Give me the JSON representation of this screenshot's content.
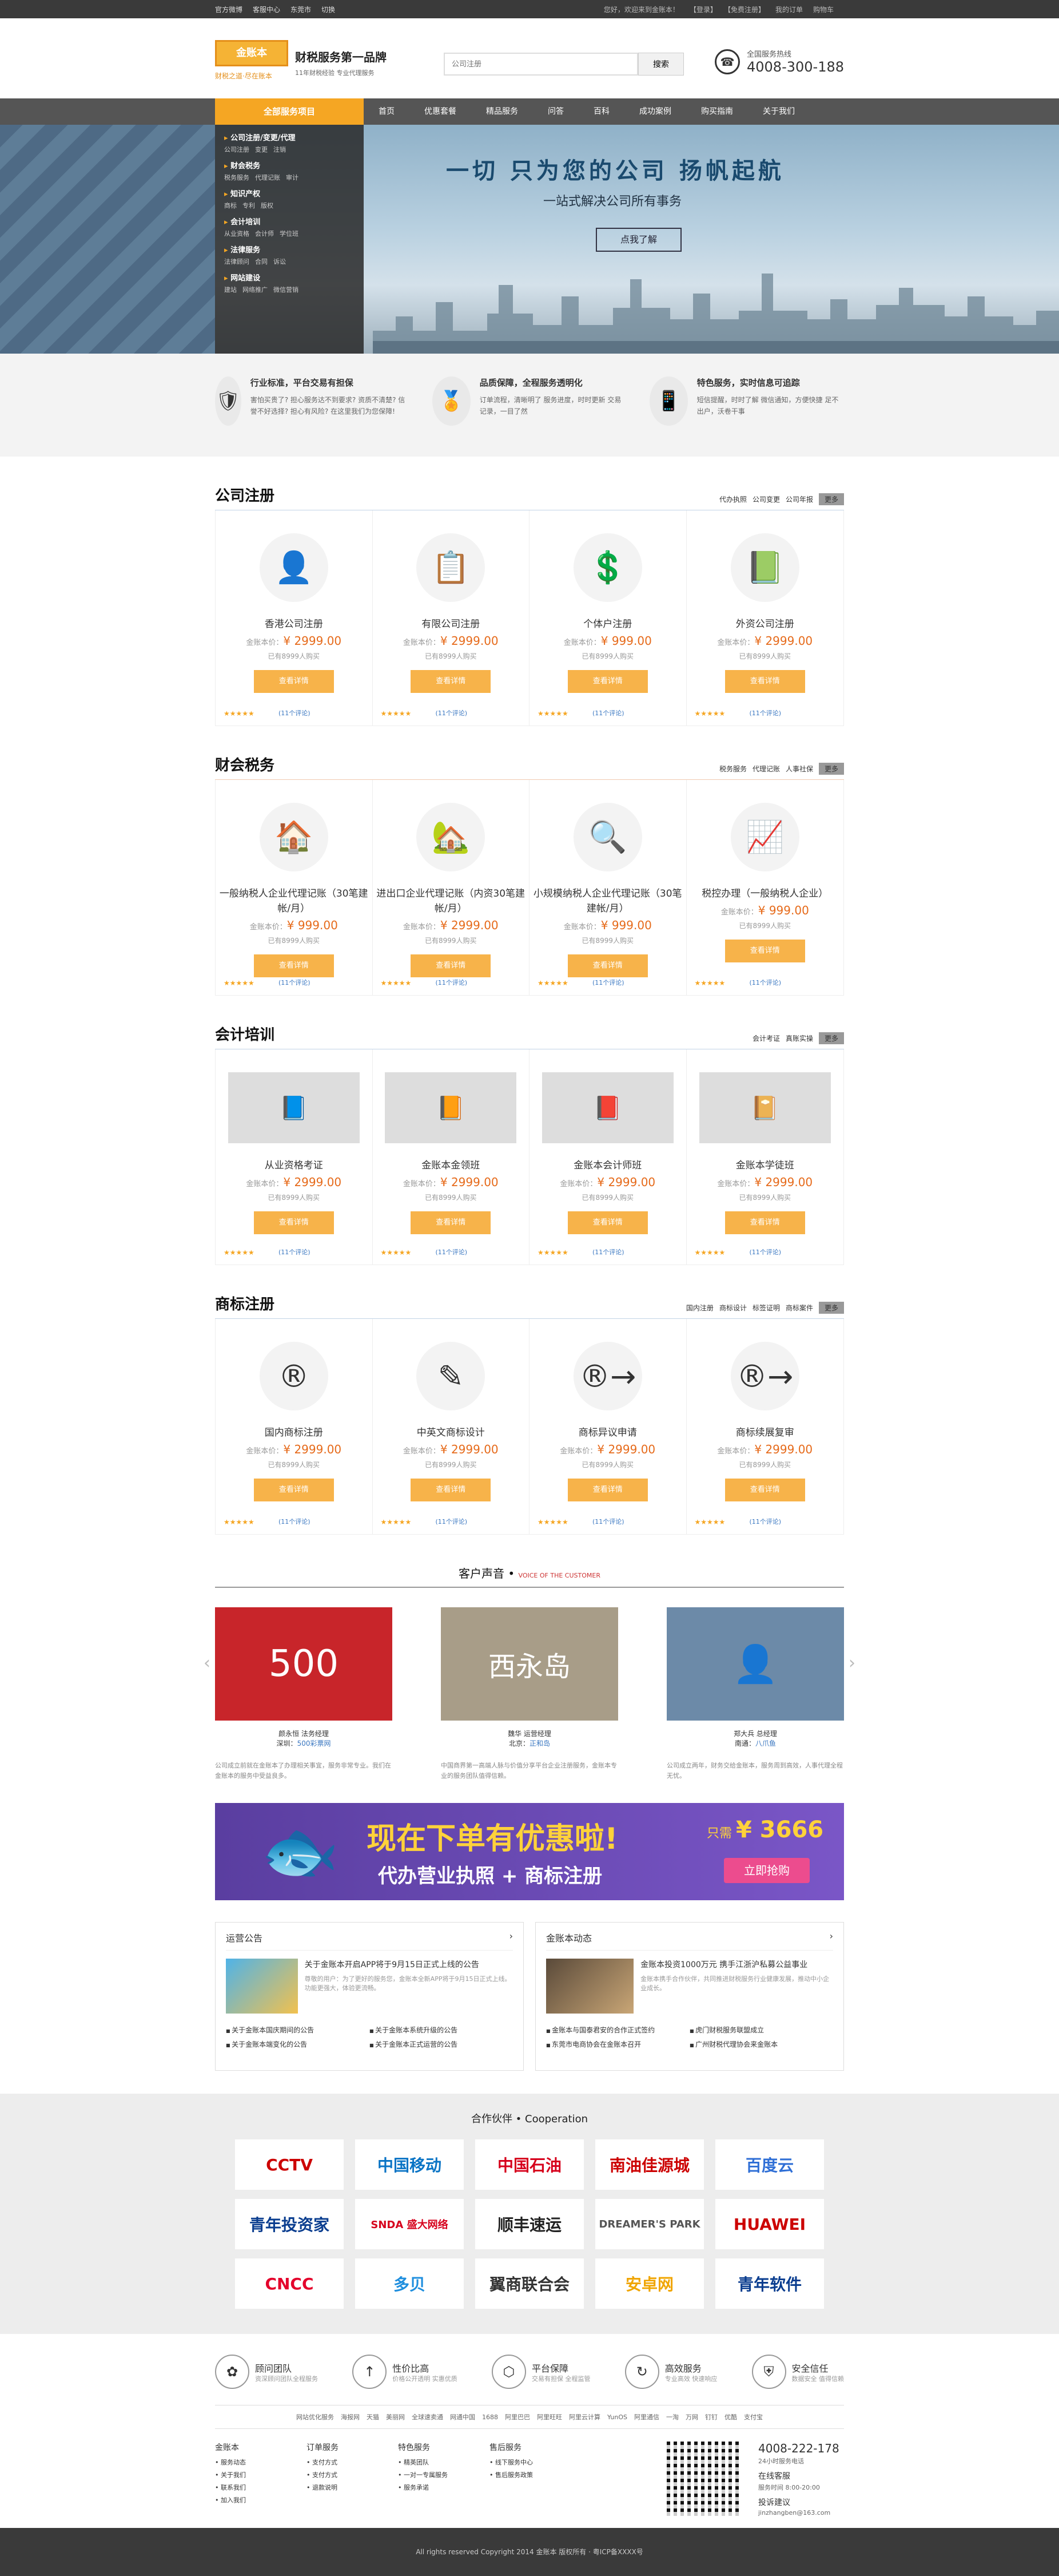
{
  "topbar": {
    "l1": "官方微博",
    "l2": "客服中心",
    "l3": "东莞市",
    "l4": "切换",
    "r1": "您好，欢迎来到金账本！",
    "r2": "【登录】",
    "r3": "【免费注册】",
    "r4": "我的订单",
    "r5": "购物车"
  },
  "header": {
    "logo": "金账本",
    "logo_sub": "财税之道·尽在账本",
    "slogan": "财税服务第一品牌",
    "slogan_sub": "11年财税经验 专业代理服务",
    "search_placeholder": "公司注册",
    "search_btn": "搜索",
    "phone_label": "全国服务热线",
    "phone": "4008-300-188"
  },
  "nav": {
    "all": "全部服务项目",
    "items": [
      "首页",
      "优惠套餐",
      "精品服务",
      "问答",
      "百科",
      "成功案例",
      "购买指南",
      "关于我们"
    ]
  },
  "banner": {
    "title": "一切 只为您的公司 扬帆起航",
    "sub": "一站式解决公司所有事务",
    "btn": "点我了解",
    "menu": [
      {
        "h": "公司注册/变更/代理",
        "s": [
          "公司注册",
          "变更",
          "注销"
        ]
      },
      {
        "h": "财会税务",
        "s": [
          "税务服务",
          "代理记账",
          "审计"
        ]
      },
      {
        "h": "知识产权",
        "s": [
          "商标",
          "专利",
          "版权"
        ]
      },
      {
        "h": "会计培训",
        "s": [
          "从业资格",
          "会计师",
          "学位班"
        ]
      },
      {
        "h": "法律服务",
        "s": [
          "法律顾问",
          "合同",
          "诉讼"
        ]
      },
      {
        "h": "网站建设",
        "s": [
          "建站",
          "网络推广",
          "微信营销"
        ]
      }
    ]
  },
  "adv": [
    {
      "t": "行业标准，平台交易有担保",
      "d": "害怕买贵了? 担心服务达不到要求? 资质不清楚? 信誉不好选择? 担心有风险? 在这里我们为您保障!"
    },
    {
      "t": "品质保障，全程服务透明化",
      "d": "订单流程，清晰明了 服务进度，时时更新 交易记录，一目了然"
    },
    {
      "t": "特色服务，实时信息可追踪",
      "d": "短信提醒，时时了解 微信通知，方便快捷 足不出户，沃卷干事"
    }
  ],
  "sections": [
    {
      "t": "公司注册",
      "links": [
        "代办执照",
        "公司变更",
        "公司年报"
      ],
      "cards": [
        {
          "ic": "👤",
          "nm": "香港公司注册",
          "p": "¥ 2999.00",
          "s": "已有8999人购买"
        },
        {
          "ic": "📋",
          "nm": "有限公司注册",
          "p": "¥ 2999.00",
          "s": "已有8999人购买"
        },
        {
          "ic": "💲",
          "nm": "个体户注册",
          "p": "¥ 999.00",
          "s": "已有8999人购买"
        },
        {
          "ic": "📗",
          "nm": "外资公司注册",
          "p": "¥ 2999.00",
          "s": "已有8999人购买"
        }
      ]
    },
    {
      "t": "财会税务",
      "links": [
        "税务服务",
        "代理记账",
        "人事社保"
      ],
      "cards": [
        {
          "ic": "🏠",
          "nm": "一般纳税人企业代理记账（30笔建帐/月）",
          "p": "¥ 999.00",
          "s": "已有8999人购买"
        },
        {
          "ic": "🏡",
          "nm": "进出口企业代理记账（内资30笔建帐/月）",
          "p": "¥ 2999.00",
          "s": "已有8999人购买"
        },
        {
          "ic": "🔍",
          "nm": "小规模纳税人企业代理记账（30笔建帐/月）",
          "p": "¥ 999.00",
          "s": "已有8999人购买"
        },
        {
          "ic": "📈",
          "nm": "税控办理（一般纳税人企业）",
          "p": "¥ 999.00",
          "s": "已有8999人购买"
        }
      ]
    },
    {
      "t": "会计培训",
      "links": [
        "会计考证",
        "真账实操"
      ],
      "cards": [
        {
          "ic": "📘",
          "nm": "从业资格考证",
          "p": "¥ 2999.00",
          "s": "已有8999人购买"
        },
        {
          "ic": "📙",
          "nm": "金账本金领班",
          "p": "¥ 2999.00",
          "s": "已有8999人购买"
        },
        {
          "ic": "📕",
          "nm": "金账本会计师班",
          "p": "¥ 2999.00",
          "s": "已有8999人购买"
        },
        {
          "ic": "📔",
          "nm": "金账本学徒班",
          "p": "¥ 2999.00",
          "s": "已有8999人购买"
        }
      ]
    },
    {
      "t": "商标注册",
      "links": [
        "国内注册",
        "商标设计",
        "标签证明",
        "商标案件"
      ],
      "cards": [
        {
          "ic": "®",
          "nm": "国内商标注册",
          "p": "¥ 2999.00",
          "s": "已有8999人购买"
        },
        {
          "ic": "✎",
          "nm": "中英文商标设计",
          "p": "¥ 2999.00",
          "s": "已有8999人购买"
        },
        {
          "ic": "®→",
          "nm": "商标异议申请",
          "p": "¥ 2999.00",
          "s": "已有8999人购买"
        },
        {
          "ic": "®→",
          "nm": "商标续展复审",
          "p": "¥ 2999.00",
          "s": "已有8999人购买"
        }
      ]
    }
  ],
  "card_common": {
    "price_label": "金账本价",
    "btn": "查看详情",
    "stars": "★★★★★",
    "comments": "(11个评论)",
    "more": "更多"
  },
  "voice": {
    "t": "客户声音 •",
    "en": "VOICE OF THE CUSTOMER",
    "items": [
      {
        "p": "500",
        "bg": "#c8252a",
        "n": "颜永恒  法务经理",
        "c": "深圳",
        "a": "500彩票网",
        "d": "公司成立前就在金账本了办理相关事宜，服务非常专业。我们在金账本的服务中受益良多。"
      },
      {
        "p": "西永岛",
        "bg": "#a89d88",
        "n": "魏华  运营经理",
        "c": "北京",
        "a": "正和岛",
        "d": "中国商界第一高端人脉与价值分享平台企业注册服务，金账本专业的服务团队值得信赖。"
      },
      {
        "p": "👤",
        "bg": "#6c8aa8",
        "n": "郑大兵  总经理",
        "c": "南通",
        "a": "八爪鱼",
        "d": "公司成立两年，财务交给金账本，服务周到高效，人事代理全程无忧。"
      }
    ]
  },
  "promo": {
    "t": "现在下单有优惠啦!",
    "s": "代办营业执照 + 商标注册",
    "p_label": "只需",
    "p": "¥ 3666",
    "btn": "立即抢购"
  },
  "news": [
    {
      "h": "运营公告",
      "pt": "关于金账本开启APP将于9月15日正式上线的公告",
      "pd": "尊敬的用户：为了更好的服务您，金账本全新APP将于9月15日正式上线。功能更强大，体验更流畅。",
      "li": [
        "关于金账本国庆期间的公告",
        "关于金账本系统升级的公告",
        "关于金账本端变化的公告",
        "关于金账本正式运营的公告"
      ]
    },
    {
      "h": "金账本动态",
      "pt": "金账本投资1000万元 携手江浙沪私募公益事业",
      "pd": "金账本携手合作伙伴，共同推进财税服务行业健康发展，推动中小企业成长。",
      "li": [
        "金账本与国泰君安的合作正式签约",
        "虎门财税服务联盟成立",
        "东莞市电商协会在金账本召开",
        "广州财税代理协会来金账本"
      ]
    }
  ],
  "partners": {
    "t": "合作伙伴 • Cooperation",
    "list": [
      {
        "n": "CCTV",
        "c": "#c00"
      },
      {
        "n": "中国移动",
        "c": "#0a74c5"
      },
      {
        "n": "中国石油",
        "c": "#d6001c"
      },
      {
        "n": "南油佳源城",
        "c": "#c00"
      },
      {
        "n": "百度云",
        "c": "#2f6fd6"
      },
      {
        "n": "青年投资家",
        "c": "#0a3d8f"
      },
      {
        "n": "SNDA 盛大网络",
        "c": "#d6001c"
      },
      {
        "n": "顺丰速运",
        "c": "#222"
      },
      {
        "n": "DREAMER'S PARK",
        "c": "#555"
      },
      {
        "n": "HUAWEI",
        "c": "#c00"
      },
      {
        "n": "CNCC",
        "c": "#e4002b"
      },
      {
        "n": "多贝",
        "c": "#1e8ede"
      },
      {
        "n": "翼商联合会",
        "c": "#333"
      },
      {
        "n": "安卓网",
        "c": "#f0a500"
      },
      {
        "n": "青年软件",
        "c": "#0a3d8f"
      }
    ]
  },
  "svc": [
    {
      "ic": "✿",
      "t": "顾问团队",
      "d": "资深顾问团队全程服务"
    },
    {
      "ic": "↑",
      "t": "性价比高",
      "d": "价格公开透明 实惠优质"
    },
    {
      "ic": "⬡",
      "t": "平台保障",
      "d": "交易有担保 全程监管"
    },
    {
      "ic": "↻",
      "t": "高效服务",
      "d": "专业高效 快速响应"
    },
    {
      "ic": "⛨",
      "t": "安全信任",
      "d": "数据安全 值得信赖"
    }
  ],
  "flinks": [
    "网站优化服务",
    "海报网",
    "天猫",
    "美丽网",
    "全球速卖通",
    "网通中国",
    "1688",
    "阿里巴巴",
    "阿里旺旺",
    "阿里云计算",
    "YunOS",
    "阿里通信",
    "一淘",
    "万网",
    "钉钉",
    "优酷",
    "支付宝"
  ],
  "foot": {
    "cols": [
      {
        "h": "金账本",
        "a": [
          "服务动态",
          "关于我们",
          "联系我们",
          "加入我们"
        ]
      },
      {
        "h": "订单服务",
        "a": [
          "支付方式",
          "支付方式",
          "退款说明"
        ]
      },
      {
        "h": "特色服务",
        "a": [
          "精英团队",
          "一对一专属服务",
          "服务承诺"
        ]
      },
      {
        "h": "售后服务",
        "a": [
          "线下服务中心",
          "售后服务政策"
        ]
      }
    ],
    "tel": "4008-222-178",
    "tel_note": "24小时服务电话",
    "online": "在线客服",
    "hours": "服务时间 8:00-20:00",
    "sugg": "投诉建议",
    "mail": "jinzhangben@163.com"
  },
  "copy": "All rights reserved Copyright 2014 金账本 版权所有 · 粤ICP备XXXX号"
}
